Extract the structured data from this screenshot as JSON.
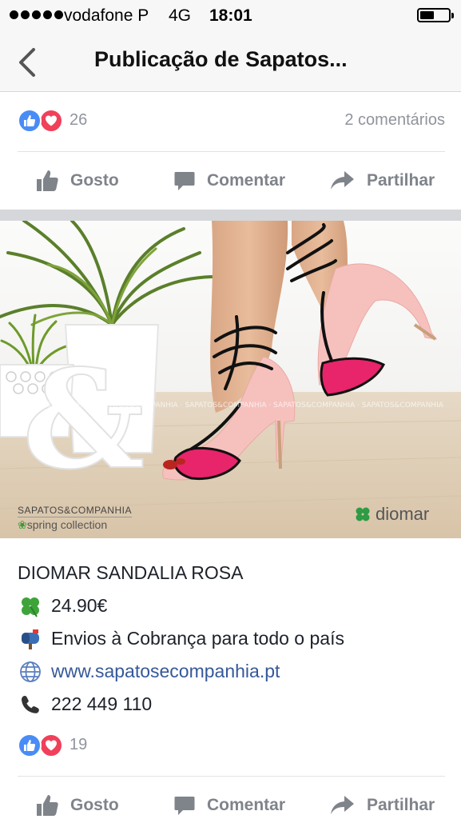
{
  "status_bar": {
    "carrier": "vodafone P",
    "network": "4G",
    "time": "18:01",
    "battery_level": 0.5
  },
  "nav": {
    "title": "Publicação de Sapatos..."
  },
  "post_top": {
    "reaction_count": "26",
    "comments_label": "2 comentários"
  },
  "actions": {
    "like_label": "Gosto",
    "comment_label": "Comentar",
    "share_label": "Partilhar"
  },
  "photo": {
    "brand": "SAPATOS&COMPANHIA",
    "collection": "spring collection",
    "logo_text": "diomar"
  },
  "post": {
    "title": "DIOMAR SANDALIA ROSA",
    "price": "24.90€",
    "shipping": "Envios à Cobrança para todo o país",
    "website": "www.sapatosecompanhia.pt",
    "phone": "222 449 110"
  },
  "post_bottom": {
    "reaction_count": "19"
  },
  "colors": {
    "like_blue": "#4a8cf5",
    "love_red": "#f0405a",
    "link_blue": "#365899",
    "shoe_pink": "#f6c1bd",
    "shoe_magenta": "#e8246a"
  }
}
